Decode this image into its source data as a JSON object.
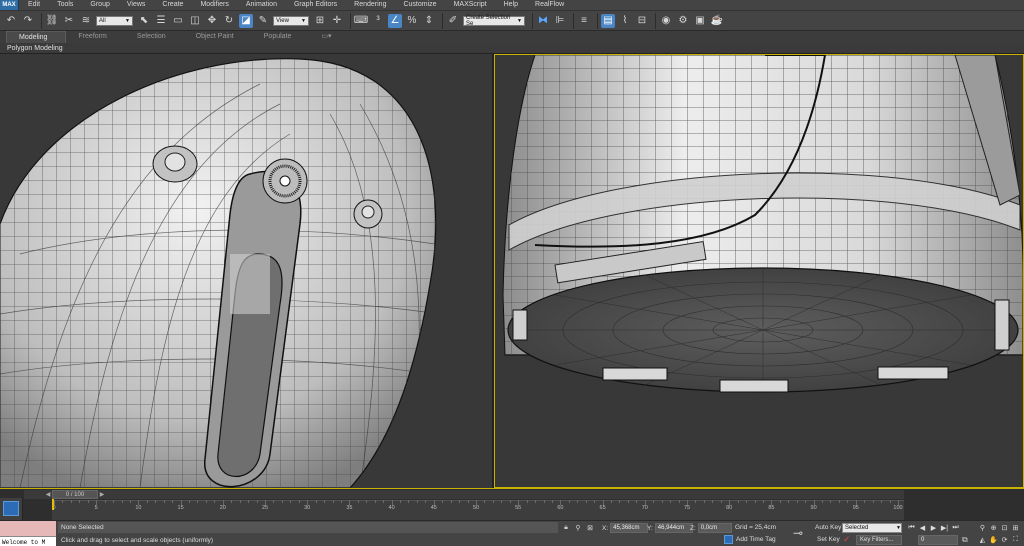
{
  "menubar": {
    "app_button": "MAX",
    "items": [
      "Edit",
      "Tools",
      "Group",
      "Views",
      "Create",
      "Modifiers",
      "Animation",
      "Graph Editors",
      "Rendering",
      "Customize",
      "MAXScript",
      "Help",
      "RealFlow"
    ]
  },
  "toolbar": {
    "selection_filter": "All",
    "reference_coord": "View",
    "named_selection": "Create Selection Se",
    "icons": [
      "undo-icon",
      "redo-icon",
      "link-icon",
      "unlink-icon",
      "bind-space-warp-icon",
      "select-object-icon",
      "select-by-name-icon",
      "rect-selection-icon",
      "window-crossing-icon",
      "select-move-icon",
      "select-rotate-icon",
      "select-scale-icon",
      "pivot-icon",
      "snap-3d-icon",
      "angle-snap-icon",
      "percent-snap-icon",
      "spinner-snap-icon",
      "edit-named-sets-icon",
      "mirror-icon",
      "align-icon",
      "layer-icon",
      "graphite-icon",
      "curve-editor-icon",
      "schematic-icon",
      "material-editor-icon",
      "render-setup-icon",
      "render-frame-icon",
      "render-icon"
    ]
  },
  "ribbon": {
    "tabs": [
      "Modeling",
      "Freeform",
      "Selection",
      "Object Paint",
      "Populate"
    ],
    "active_tab": "Modeling",
    "panel_label": "Polygon Modeling"
  },
  "timeline": {
    "frame_display": "0 / 100",
    "ticks": [
      0,
      5,
      10,
      15,
      20,
      25,
      30,
      35,
      40,
      45,
      50,
      55,
      60,
      65,
      70,
      75,
      80,
      85,
      90,
      95,
      100
    ],
    "current_frame": 0,
    "total_frames": 100
  },
  "status": {
    "maxscript_output": "Welcome to M",
    "selection": "None Selected",
    "prompt": "Click and drag to select and scale objects (uniformly)",
    "x_label": "X:",
    "x_value": "45,368cm",
    "y_label": "Y:",
    "y_value": "46,944cm",
    "z_label": "Z:",
    "z_value": "0,0cm",
    "grid": "Grid = 25,4cm",
    "add_time_tag": "Add Time Tag",
    "auto_key": "Auto Key",
    "set_key": "Set Key",
    "key_mode": "Selected",
    "key_filters": "Key Filters...",
    "frame_field": "0"
  }
}
